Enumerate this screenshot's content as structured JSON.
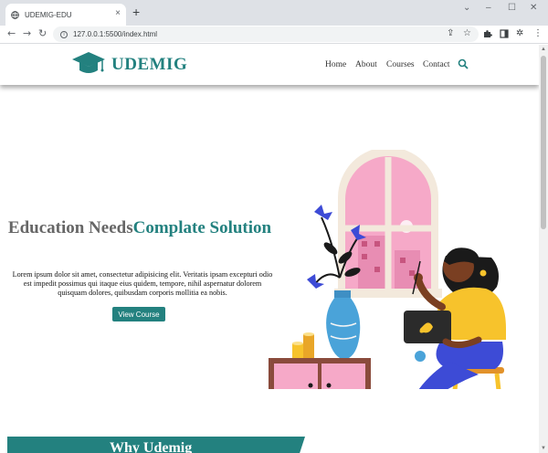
{
  "browser": {
    "tab_title": "UDEMIG-EDU",
    "tab_close": "×",
    "new_tab": "+",
    "url": "127.0.0.1:5500/index.html",
    "window_controls": [
      "⌄",
      "–",
      "☐",
      "✕"
    ]
  },
  "header": {
    "brand": "UDEMIG",
    "nav": [
      "Home",
      "About",
      "Courses",
      "Contact"
    ]
  },
  "hero": {
    "title_part1": "Education Needs",
    "title_part2": "Complate Solution",
    "text": "Lorem ipsum dolor sit amet, consectetur adipisicing elit. Veritatis ipsam excepturi odio est impedit possimus qui itaque eius quidem, tempore, nihil aspernatur dolorem quisquam dolores, quibusdam corporis mollitia ea nobis.",
    "button": "View Course"
  },
  "section": {
    "why_title": "Why Udemig"
  },
  "colors": {
    "accent": "#23817f",
    "pink": "#f8b3ce",
    "yellow": "#f7c32c",
    "blue": "#3d4bd6"
  }
}
